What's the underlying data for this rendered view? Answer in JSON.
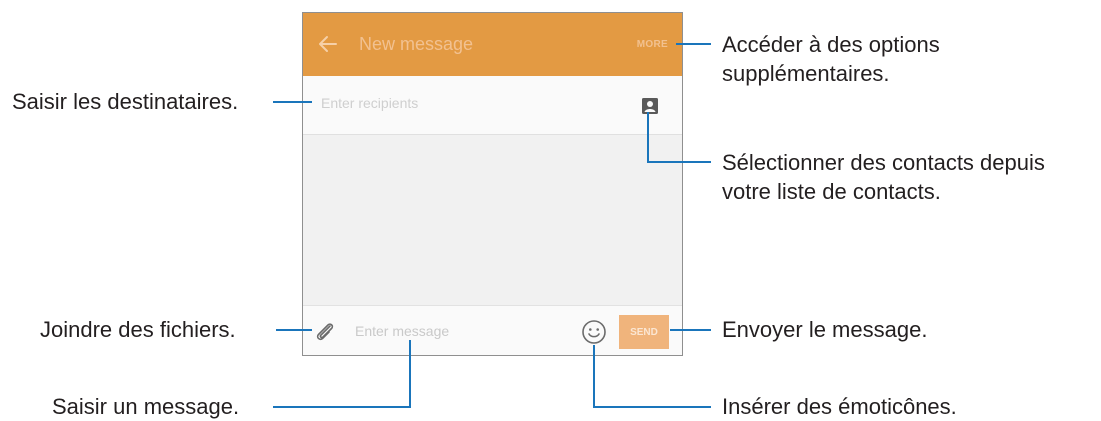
{
  "screen": {
    "title": "New message",
    "more_label": "MORE",
    "recipient_placeholder": "Enter recipients",
    "message_placeholder": "Enter message",
    "send_label": "SEND",
    "icons": {
      "back": "arrow-left",
      "contacts": "contact-card",
      "attach": "paperclip",
      "emoji": "smiley-face"
    },
    "colors": {
      "appbar": "#e39a43",
      "send_button": "#f0b47c"
    }
  },
  "callouts": {
    "more_options_line1": "Accéder à des options",
    "more_options_line2": "supplémentaires.",
    "recipients": "Saisir les destinataires.",
    "contacts_line1": "Sélectionner des contacts depuis",
    "contacts_line2": "votre liste de contacts.",
    "attach": "Joindre des fichiers.",
    "send": "Envoyer le message.",
    "message": "Saisir un message.",
    "emoticons": "Insérer des émoticônes."
  }
}
